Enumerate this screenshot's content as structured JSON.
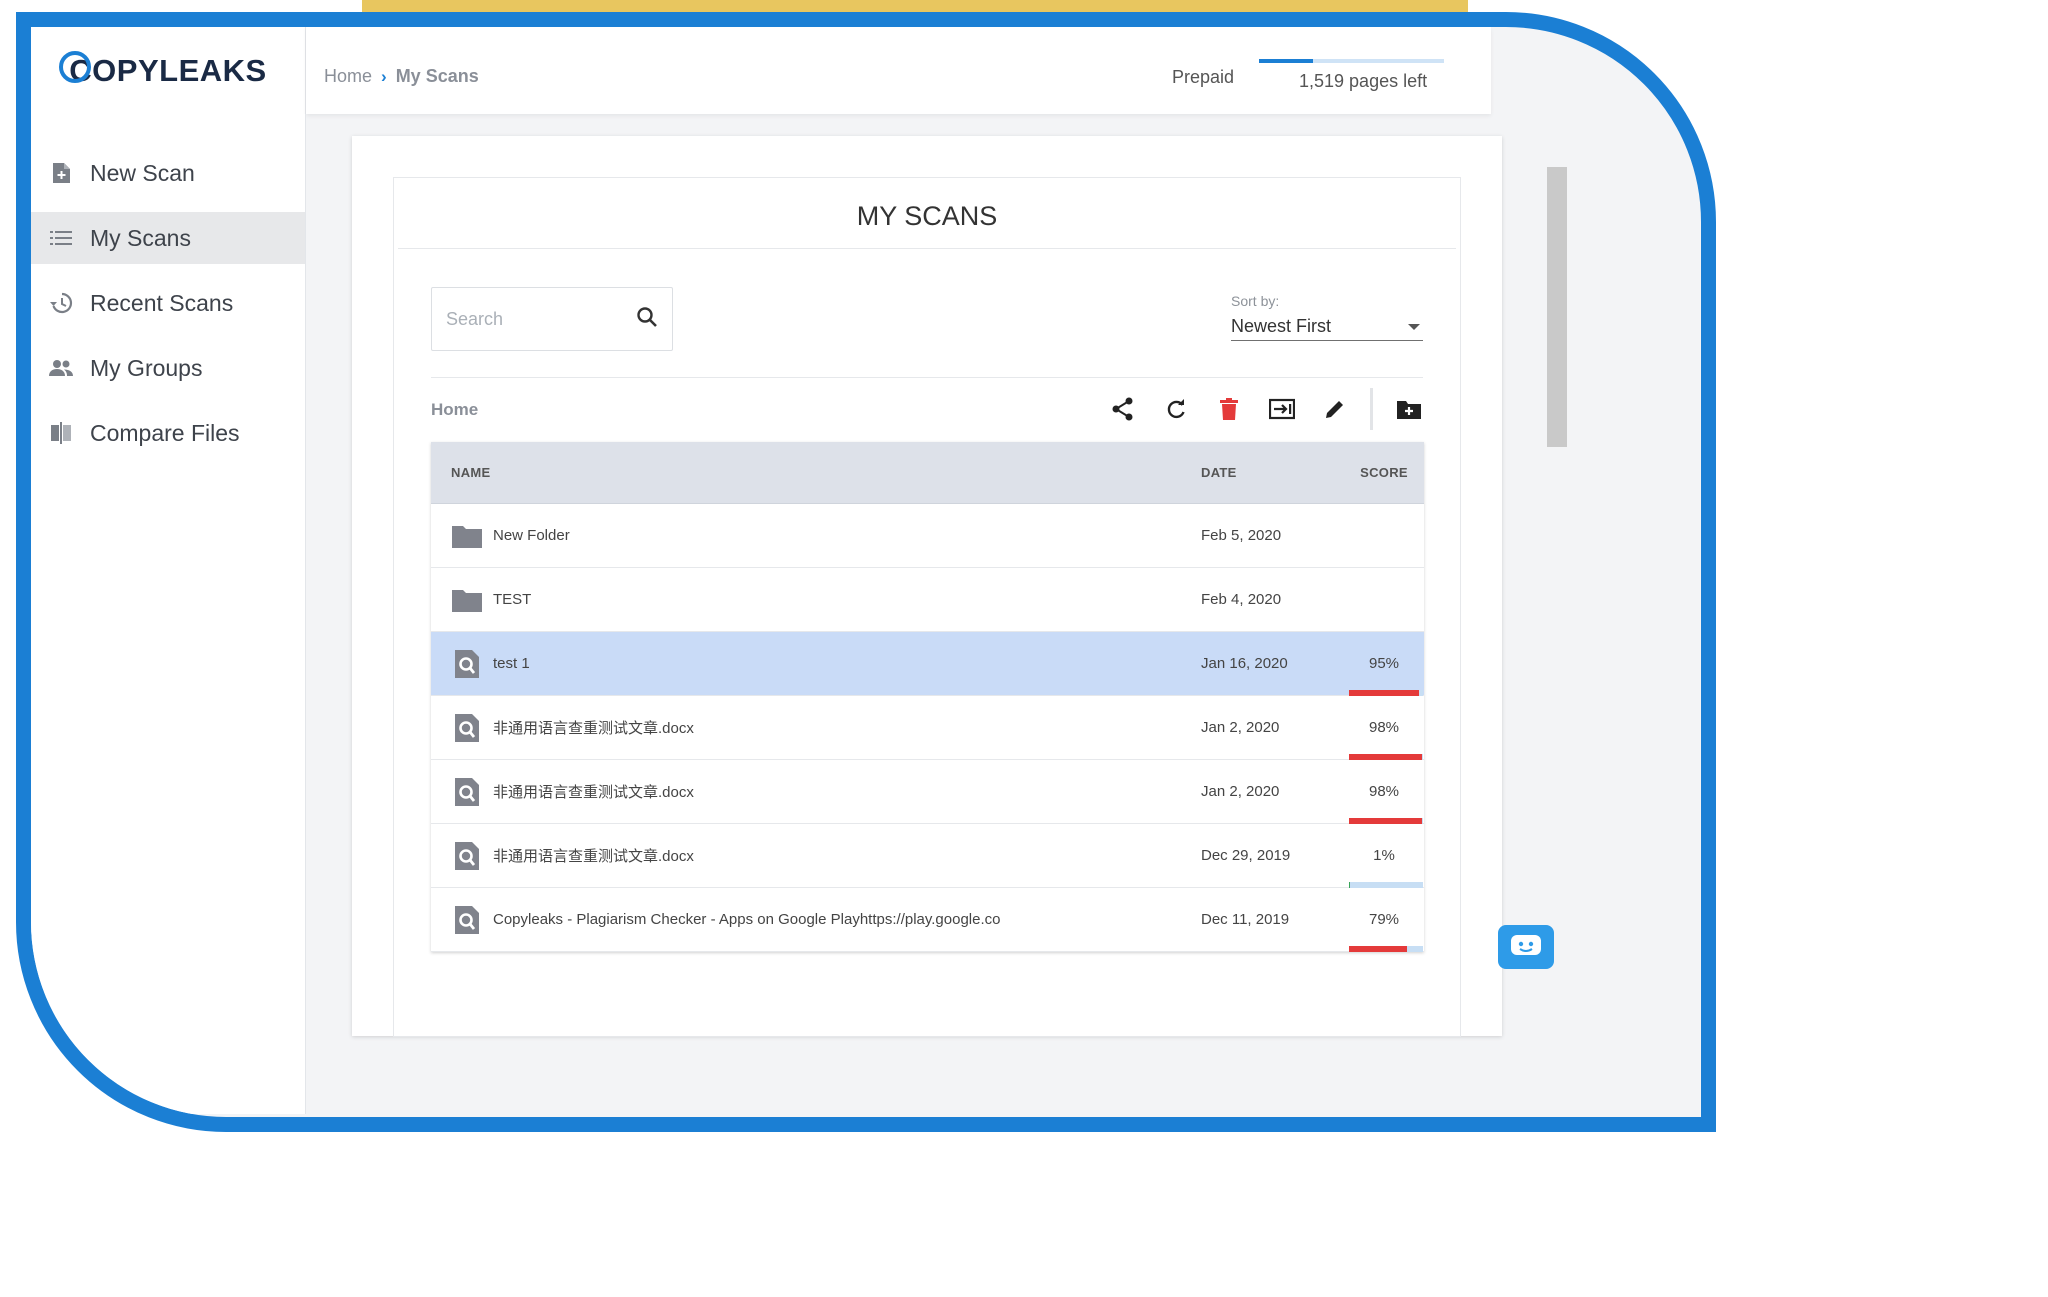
{
  "brand": {
    "logo_text": "COPYLEAKS",
    "accent": "#1b7fd4"
  },
  "header": {
    "breadcrumb_home": "Home",
    "breadcrumb_current": "My Scans",
    "plan": "Prepaid",
    "pages_left": "1,519 pages left"
  },
  "sidebar": {
    "items": [
      {
        "label": "New Scan",
        "icon": "new-file-icon"
      },
      {
        "label": "My Scans",
        "icon": "list-icon",
        "active": true
      },
      {
        "label": "Recent Scans",
        "icon": "history-icon"
      },
      {
        "label": "My Groups",
        "icon": "people-icon"
      },
      {
        "label": "Compare Files",
        "icon": "compare-icon"
      }
    ]
  },
  "main": {
    "title": "MY SCANS",
    "search": {
      "placeholder": "Search",
      "value": ""
    },
    "sort": {
      "label": "Sort by:",
      "value": "Newest First"
    },
    "folder": "Home",
    "toolbar": [
      "share-icon",
      "refresh-icon",
      "delete-icon",
      "move-icon",
      "edit-icon",
      "new-folder-icon"
    ],
    "columns": {
      "name": "NAME",
      "date": "DATE",
      "score": "SCORE"
    },
    "rows": [
      {
        "type": "folder",
        "name": "New Folder",
        "date": "Feb 5, 2020",
        "score": ""
      },
      {
        "type": "folder",
        "name": "TEST",
        "date": "Feb 4, 2020",
        "score": ""
      },
      {
        "type": "scan",
        "name": "test 1",
        "date": "Jan 16, 2020",
        "score": "95%",
        "selected": true
      },
      {
        "type": "scan",
        "name": "非通用语言查重测试文章.docx",
        "date": "Jan 2, 2020",
        "score": "98%"
      },
      {
        "type": "scan",
        "name": "非通用语言查重测试文章.docx",
        "date": "Jan 2, 2020",
        "score": "98%"
      },
      {
        "type": "scan",
        "name": "非通用语言查重测试文章.docx",
        "date": "Dec 29, 2019",
        "score": "1%"
      },
      {
        "type": "scan",
        "name": "Copyleaks - Plagiarism Checker - Apps on Google Playhttps://play.google.co",
        "date": "Dec 11, 2019",
        "score": "79%"
      }
    ]
  },
  "colors": {
    "selected_row": "#c9dbf7",
    "score_high": "#e43a3a",
    "score_track": "#c7def4",
    "header_row": "#dde1e9"
  }
}
